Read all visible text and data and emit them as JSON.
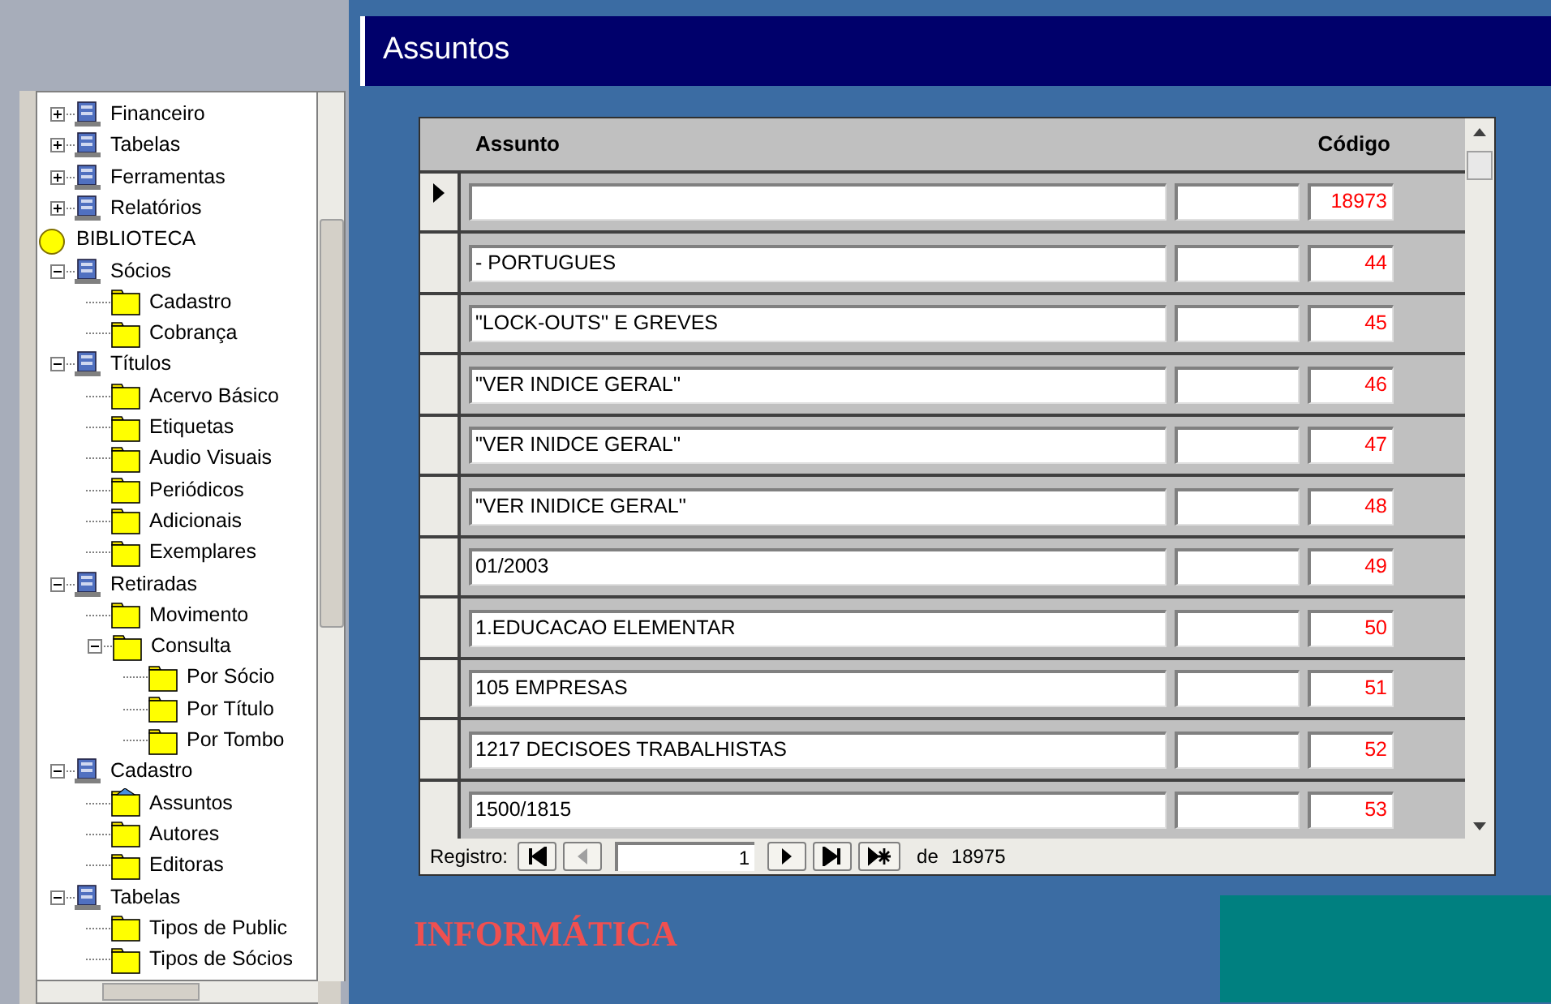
{
  "window": {
    "title": "Assuntos"
  },
  "tree": [
    {
      "label": "Financeiro",
      "kind": "module",
      "expanded": false
    },
    {
      "label": "Tabelas",
      "kind": "module",
      "expanded": false
    },
    {
      "label": "Ferramentas",
      "kind": "module",
      "expanded": false
    },
    {
      "label": "Relatórios",
      "kind": "module",
      "expanded": false
    },
    {
      "label": "BIBLIOTECA",
      "kind": "root"
    },
    {
      "label": "Sócios",
      "kind": "module",
      "expanded": true,
      "children": [
        {
          "label": "Cadastro",
          "kind": "folder"
        },
        {
          "label": "Cobrança",
          "kind": "folder"
        }
      ]
    },
    {
      "label": "Títulos",
      "kind": "module",
      "expanded": true,
      "children": [
        {
          "label": "Acervo Básico",
          "kind": "folder"
        },
        {
          "label": "Etiquetas",
          "kind": "folder"
        },
        {
          "label": "Audio Visuais",
          "kind": "folder"
        },
        {
          "label": "Periódicos",
          "kind": "folder"
        },
        {
          "label": "Adicionais",
          "kind": "folder"
        },
        {
          "label": "Exemplares",
          "kind": "folder"
        }
      ]
    },
    {
      "label": "Retiradas",
      "kind": "module",
      "expanded": true,
      "children": [
        {
          "label": "Movimento",
          "kind": "folder"
        },
        {
          "label": "Consulta",
          "kind": "folder",
          "expanded": true,
          "children": [
            {
              "label": "Por Sócio",
              "kind": "folder"
            },
            {
              "label": "Por Título",
              "kind": "folder"
            },
            {
              "label": "Por Tombo",
              "kind": "folder"
            }
          ]
        }
      ]
    },
    {
      "label": "Cadastro",
      "kind": "module",
      "expanded": true,
      "children": [
        {
          "label": "Assuntos",
          "kind": "open-folder"
        },
        {
          "label": "Autores",
          "kind": "folder"
        },
        {
          "label": "Editoras",
          "kind": "folder"
        }
      ]
    },
    {
      "label": "Tabelas",
      "kind": "module",
      "expanded": true,
      "children": [
        {
          "label": "Tipos de Public",
          "kind": "folder"
        },
        {
          "label": "Tipos de Sócios",
          "kind": "folder"
        }
      ]
    }
  ],
  "form": {
    "columns": [
      "Assunto",
      "Código"
    ],
    "rows": [
      {
        "current": true,
        "codigo": "18973"
      },
      {
        "current": false,
        "assunto": "- PORTUGUES",
        "codigo": "44"
      },
      {
        "current": false,
        "assunto": "\"LOCK-OUTS'' E GREVES",
        "codigo": "45"
      },
      {
        "current": false,
        "assunto": "\"VER INDICE GERAL''",
        "codigo": "46"
      },
      {
        "current": false,
        "assunto": "\"VER INIDCE GERAL''",
        "codigo": "47"
      },
      {
        "current": false,
        "assunto": "\"VER INIDICE GERAL''",
        "codigo": "48"
      },
      {
        "current": false,
        "assunto": "01/2003",
        "codigo": "49"
      },
      {
        "current": false,
        "assunto": "1.EDUCACAO ELEMENTAR",
        "codigo": "50"
      },
      {
        "current": false,
        "assunto": "105 EMPRESAS",
        "codigo": "51"
      },
      {
        "current": false,
        "assunto": "1217 DECISOES TRABALHISTAS",
        "codigo": "52"
      },
      {
        "current": false,
        "assunto": "1500/1815",
        "codigo": "53"
      }
    ],
    "navigator": {
      "label": "Registro:",
      "record": "1",
      "of": "de",
      "total": "18975",
      "buttons": [
        {
          "kind": "first",
          "disabled": false
        },
        {
          "kind": "previous",
          "disabled": true
        },
        {
          "kind": "field"
        },
        {
          "kind": "next",
          "disabled": false
        },
        {
          "kind": "last",
          "disabled": false
        },
        {
          "kind": "new",
          "disabled": false
        }
      ]
    }
  },
  "footer": {
    "brand": "INFORMÁTICA"
  }
}
